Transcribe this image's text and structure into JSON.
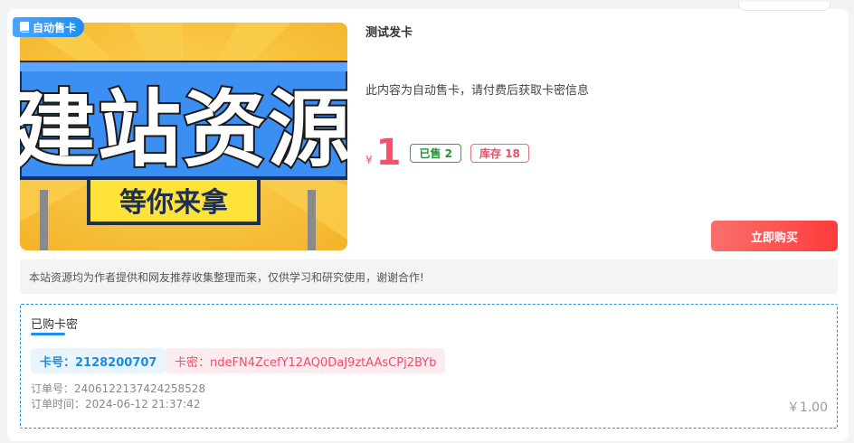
{
  "badge": {
    "label": "自动售卡"
  },
  "banner": {
    "big_text": "建站资源",
    "sub_text": "等你来拿"
  },
  "product": {
    "title": "测试发卡",
    "description": "此内容为自动售卡，请付费后获取卡密信息",
    "currency_symbol": "¥",
    "price": "1",
    "sold_label": "已售 2",
    "stock_label": "库存 18"
  },
  "buy_button": {
    "label": "立即购买"
  },
  "notice": {
    "text": "本站资源均为作者提供和网友推荐收集整理而来，仅供学习和研究使用，谢谢合作!"
  },
  "purchased": {
    "title": "已购卡密",
    "card_number": "卡号：2128200707",
    "card_key": "卡密：ndeFN4ZcefY12AQ0DaJ9ztAAsCPj2BYb",
    "order_no": "订单号：2406122137424258528",
    "order_time": "订单时间：2024-06-12 21:37:42",
    "amount": "￥1.00"
  },
  "colors": {
    "accent_blue": "#1e90e8",
    "price_red": "#ff4d6d",
    "sold_green": "#219330",
    "buy_gradient_start": "#f9706a",
    "buy_gradient_end": "#ff3b3b",
    "banner_yellow": "#f7c23a",
    "banner_blue": "#3a8ef2"
  }
}
